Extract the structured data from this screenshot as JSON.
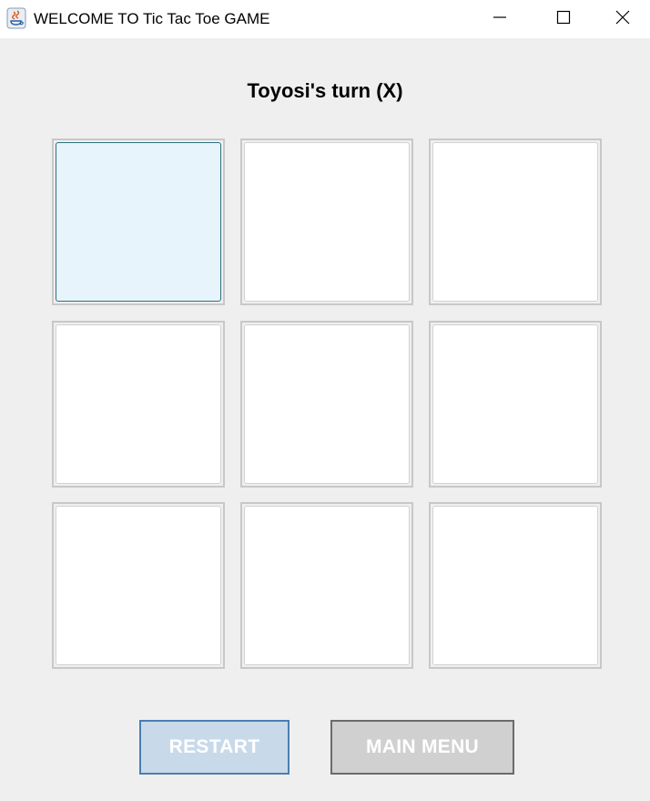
{
  "window": {
    "title": "WELCOME TO Tic Tac Toe GAME",
    "icon": "java-icon"
  },
  "game": {
    "turn_label": "Toyosi's turn (X)",
    "board": [
      [
        "",
        "",
        ""
      ],
      [
        "",
        "",
        ""
      ],
      [
        "",
        "",
        ""
      ]
    ],
    "focused_cell": [
      0,
      0
    ]
  },
  "buttons": {
    "restart_label": "RESTART",
    "main_menu_label": "MAIN MENU"
  },
  "colors": {
    "background": "#efefef",
    "focused_cell": "#e8f4fc",
    "restart_button": "#c8d9ea",
    "main_menu_button": "#d0d0d0"
  }
}
